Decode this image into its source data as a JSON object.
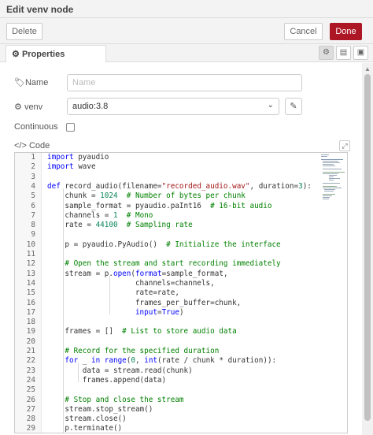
{
  "header": {
    "title": "Edit venv node"
  },
  "toolbar": {
    "delete_label": "Delete",
    "cancel_label": "Cancel",
    "done_label": "Done",
    "done_color": "#ad1625"
  },
  "tabs": {
    "properties_label": "Properties",
    "icons": [
      "gear-icon",
      "description-icon",
      "appearance-icon"
    ]
  },
  "form": {
    "name": {
      "label": "Name",
      "placeholder": "Name",
      "icon": "tag-icon"
    },
    "venv": {
      "label": "venv",
      "value": "audio:3.8",
      "icon": "cogs-icon"
    },
    "continuous": {
      "label": "Continuous",
      "checked": false
    },
    "code": {
      "label": "Code",
      "icon": "code-icon"
    }
  },
  "editor": {
    "lines": [
      "1",
      "2",
      "3",
      "4",
      "5",
      "6",
      "7",
      "8",
      "9",
      "10",
      "11",
      "12",
      "13",
      "14",
      "15",
      "16",
      "17",
      "18",
      "19",
      "20",
      "21",
      "22",
      "23",
      "24",
      "25",
      "26",
      "27",
      "28",
      "29"
    ]
  }
}
